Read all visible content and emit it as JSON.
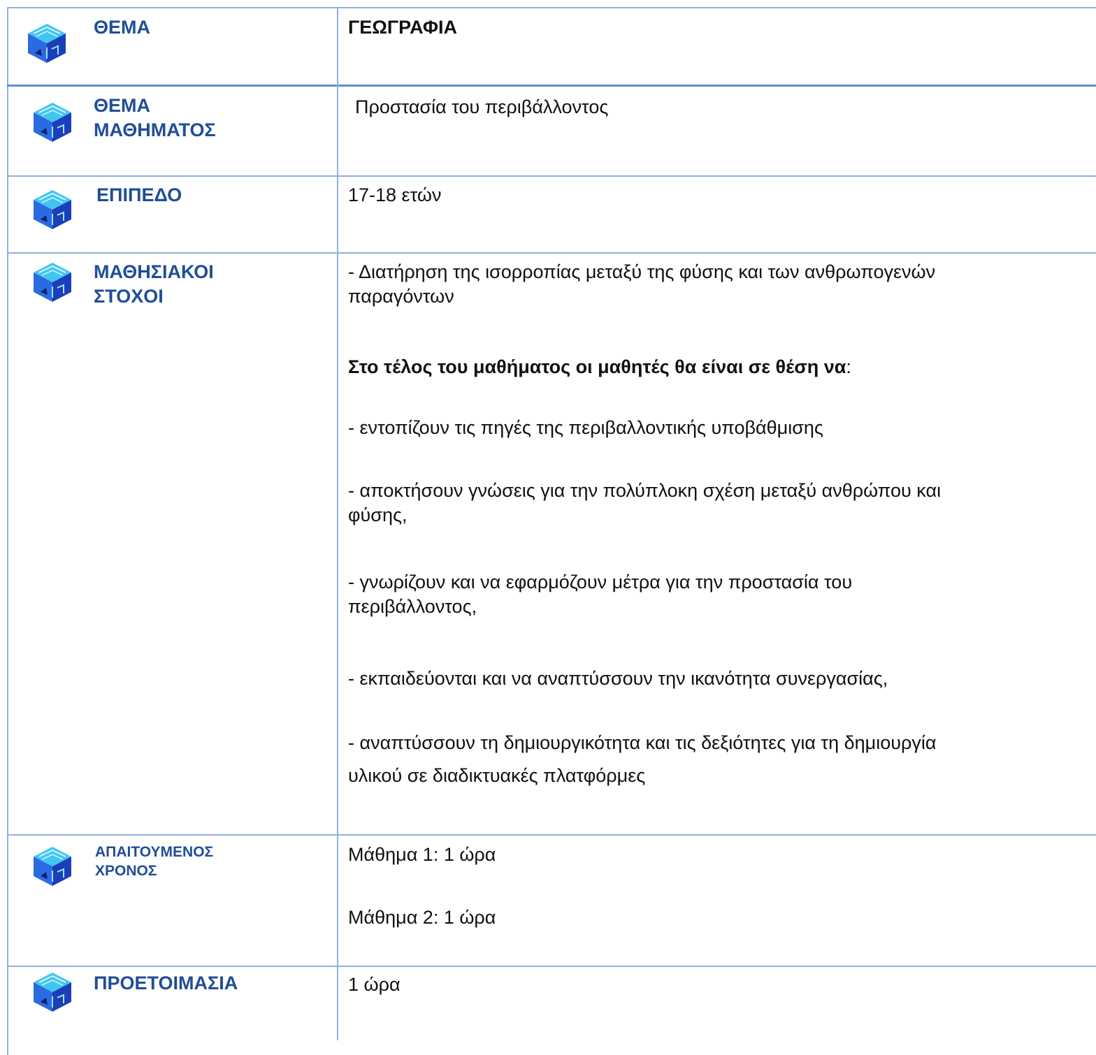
{
  "rows": [
    {
      "label": "ΘΕΜΑ",
      "value": "ΓΕΩΓΡΑΦΙΑ"
    },
    {
      "label_lines": [
        "ΘΕΜΑ",
        "ΜΑΘΗΜΑΤΟΣ"
      ],
      "value": "Προστασία του περιβάλλοντος"
    },
    {
      "label": "ΕΠΙΠΕΔΟ",
      "value": "17-18 ετών"
    },
    {
      "label_lines": [
        "ΜΑΘΗΣΙΑΚΟΙ",
        "ΣΤΟΧΟΙ"
      ],
      "intro_lines": [
        "- Διατήρηση της ισορροπίας μεταξύ της φύσης και των ανθρωπογενών",
        "παραγόντων"
      ],
      "subheading": "Στο τέλος του μαθήματος οι μαθητές θα είναι σε θέση να",
      "subheading_suffix": ":",
      "objectives": [
        {
          "lines": [
            "- εντοπίζουν τις πηγές της περιβαλλοντικής υποβάθμισης"
          ]
        },
        {
          "lines": [
            "- αποκτήσουν γνώσεις για την πολύπλοκη σχέση μεταξύ ανθρώπου και",
            "φύσης,"
          ]
        },
        {
          "lines": [
            "- γνωρίζουν και να εφαρμόζουν μέτρα για την προστασία του",
            "περιβάλλοντος,"
          ]
        },
        {
          "lines": [
            "- εκπαιδεύονται και να αναπτύσσουν την ικανότητα συνεργασίας,"
          ]
        },
        {
          "lines": [
            "- αναπτύσσουν τη δημιουργικότητα και τις δεξιότητες για τη δημιουργία",
            "υλικού σε διαδικτυακές πλατφόρμες"
          ]
        }
      ]
    },
    {
      "label_lines": [
        "ΑΠΑΙΤΟΥΜΕΝΟΣ",
        "ΧΡΟΝΟΣ"
      ],
      "values": [
        "Μάθημα 1: 1 ώρα",
        "Μάθημα 2: 1 ώρα"
      ]
    },
    {
      "label": "ΠΡΟΕΤΟΙΜΑΣΙΑ",
      "value": "1 ώρα"
    }
  ],
  "colors": {
    "label": "#1f4e96",
    "grid": "#8fb1de",
    "grid_strong": "#5b8fd0",
    "icon_top": "#41c6f2",
    "icon_left": "#2b6be0",
    "icon_right": "#1b3fb8"
  },
  "icon": "cube-icon"
}
